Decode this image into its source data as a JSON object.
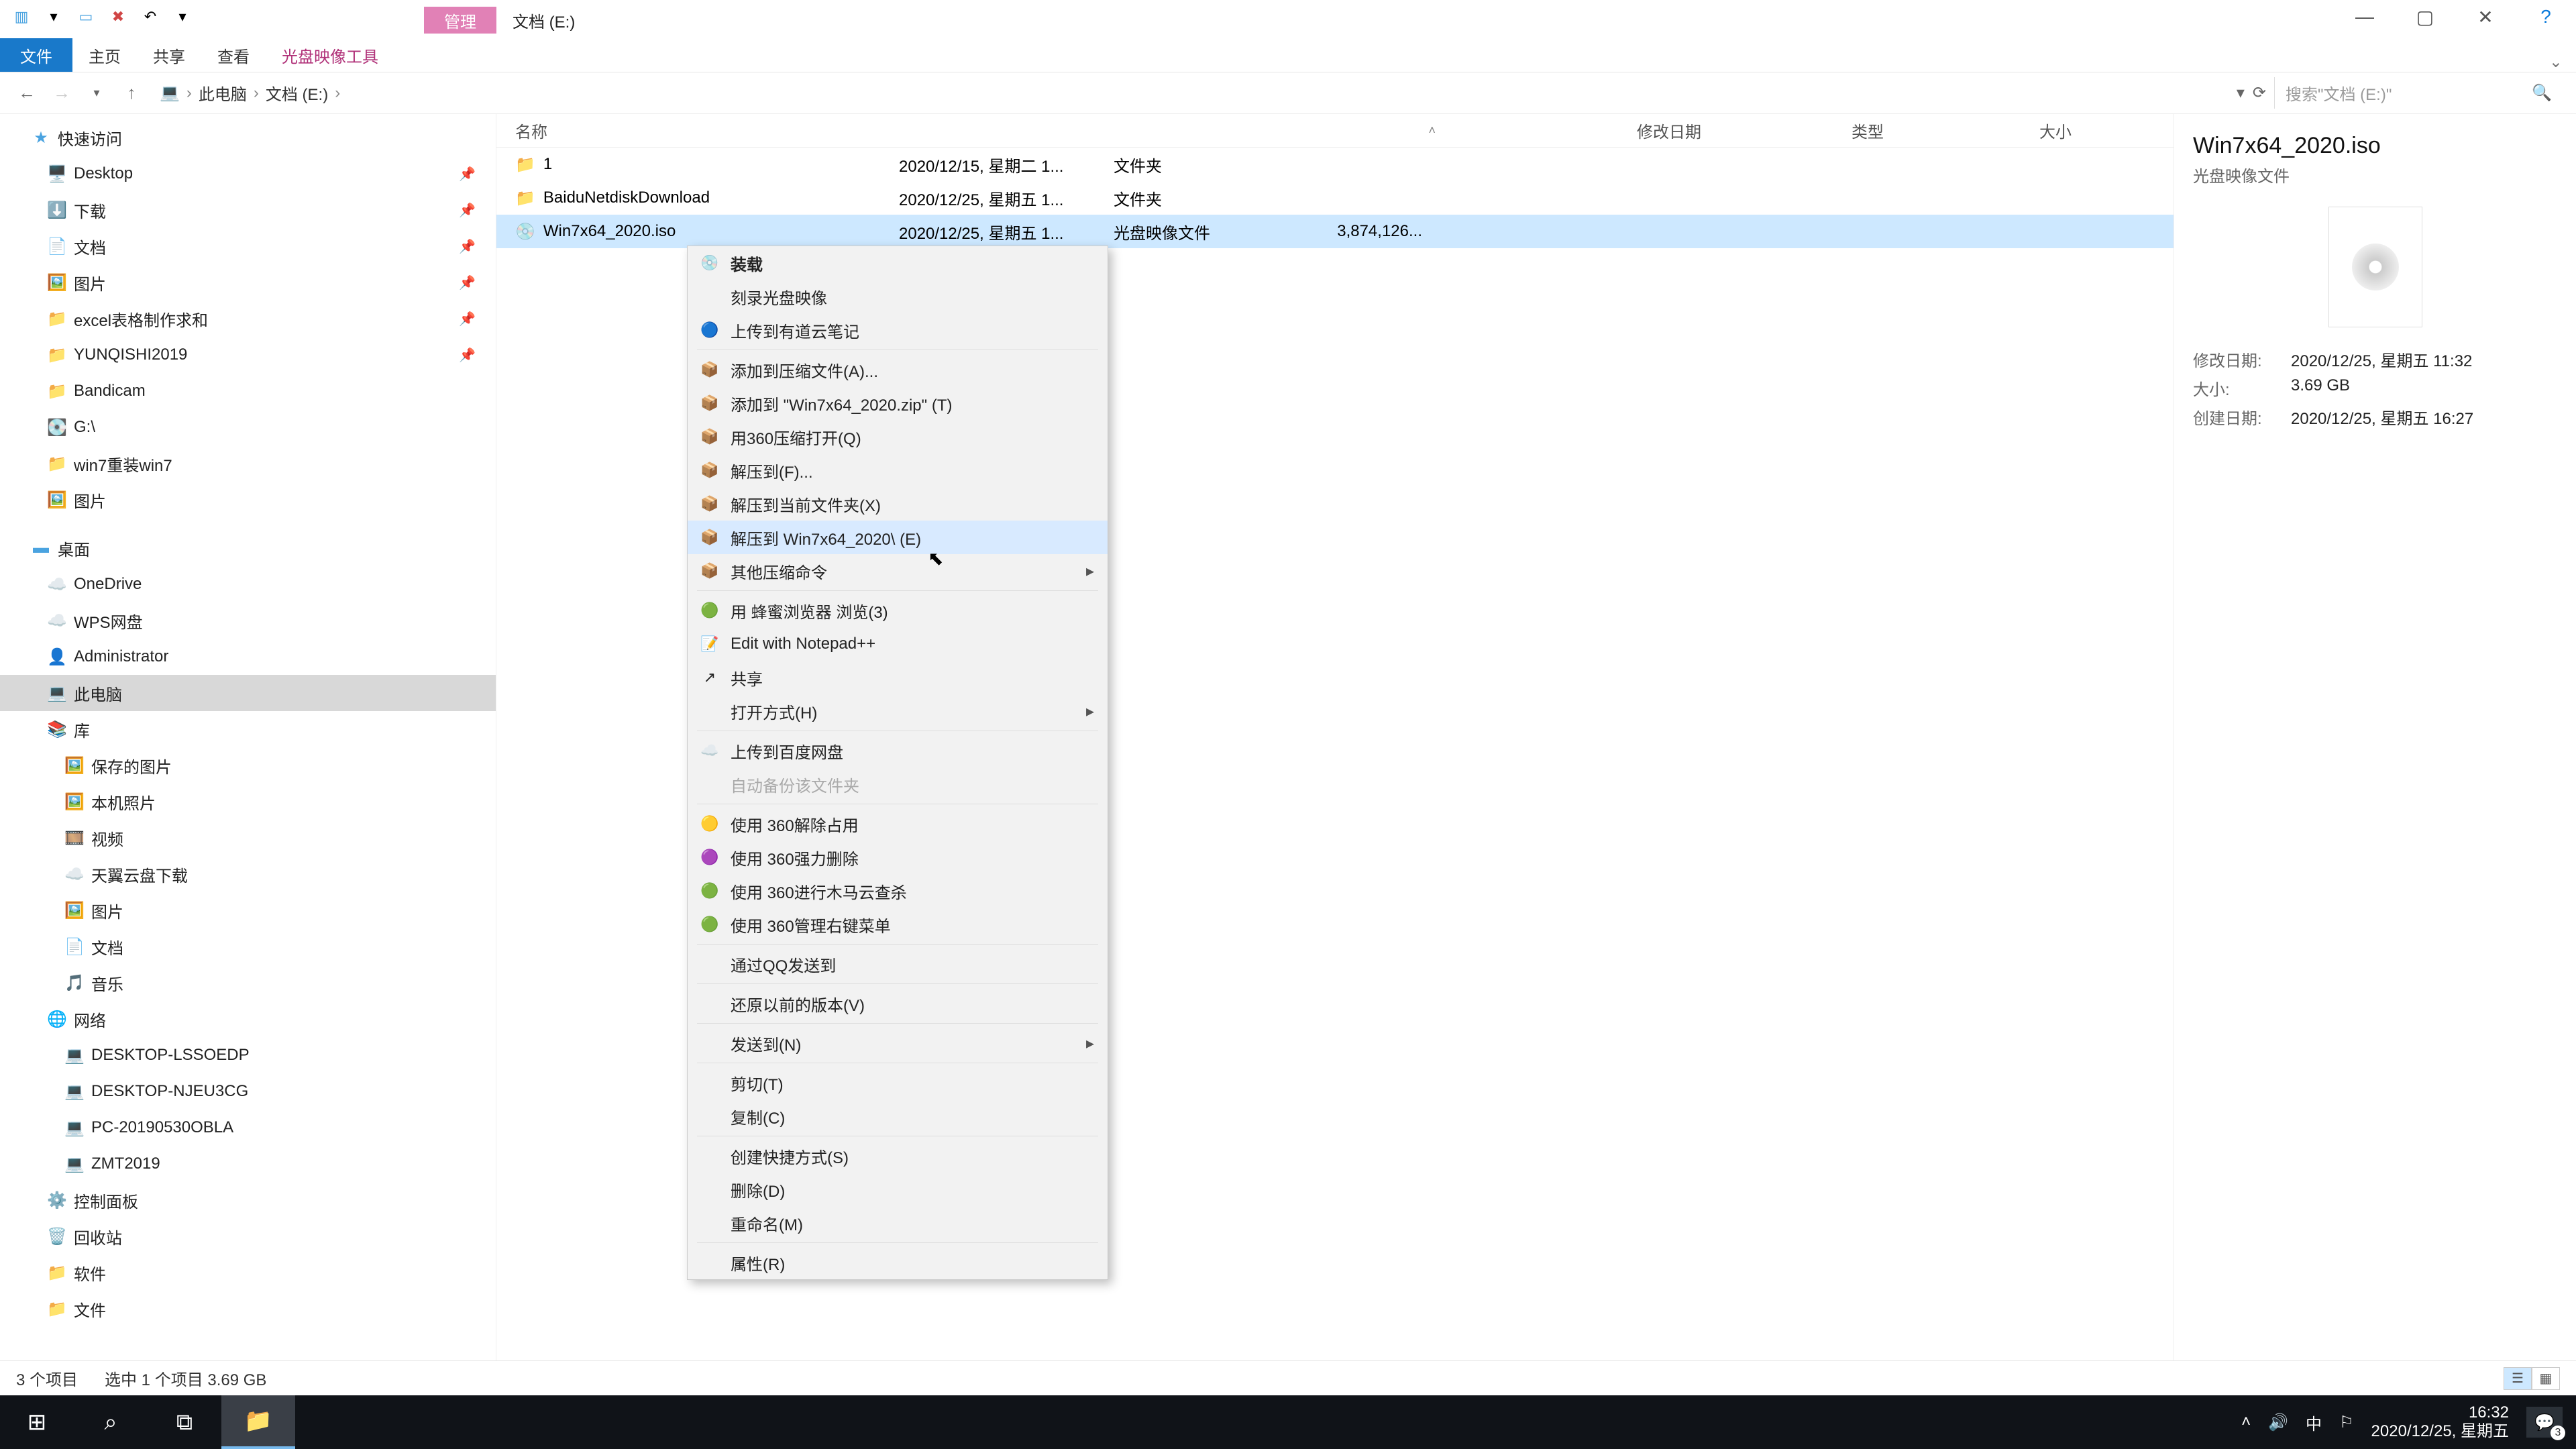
{
  "window": {
    "context_tab": "管理",
    "location_label": "文档 (E:)",
    "controls": {
      "min": "—",
      "max": "▢",
      "close": "✕",
      "help": "?"
    }
  },
  "ribbon": {
    "file": "文件",
    "tabs": [
      "主页",
      "共享",
      "查看"
    ],
    "context_tool": "光盘映像工具"
  },
  "address": {
    "crumbs": [
      "此电脑",
      "文档 (E:)"
    ],
    "search_placeholder": "搜索\"文档 (E:)\""
  },
  "tree": {
    "quick": {
      "label": "快速访问",
      "items": [
        {
          "icon": "🖥️",
          "label": "Desktop",
          "pinned": true
        },
        {
          "icon": "⬇️",
          "label": "下载",
          "pinned": true
        },
        {
          "icon": "📄",
          "label": "文档",
          "pinned": true
        },
        {
          "icon": "🖼️",
          "label": "图片",
          "pinned": true
        },
        {
          "icon": "📁",
          "label": "excel表格制作求和",
          "pinned": true
        },
        {
          "icon": "📁",
          "label": "YUNQISHI2019",
          "pinned": true
        },
        {
          "icon": "📁",
          "label": "Bandicam"
        },
        {
          "icon": "💽",
          "label": "G:\\"
        },
        {
          "icon": "📁",
          "label": "win7重装win7"
        },
        {
          "icon": "🖼️",
          "label": "图片"
        }
      ]
    },
    "desktop": {
      "label": "桌面",
      "items": [
        {
          "icon": "☁️",
          "label": "OneDrive",
          "color": "c-blue"
        },
        {
          "icon": "☁️",
          "label": "WPS网盘",
          "color": "c-blue"
        },
        {
          "icon": "👤",
          "label": "Administrator"
        },
        {
          "icon": "💻",
          "label": "此电脑",
          "selected": true
        },
        {
          "icon": "📚",
          "label": "库"
        }
      ]
    },
    "lib_items": [
      {
        "icon": "🖼️",
        "label": "保存的图片"
      },
      {
        "icon": "🖼️",
        "label": "本机照片"
      },
      {
        "icon": "🎞️",
        "label": "视频"
      },
      {
        "icon": "☁️",
        "label": "天翼云盘下载"
      },
      {
        "icon": "🖼️",
        "label": "图片"
      },
      {
        "icon": "📄",
        "label": "文档"
      },
      {
        "icon": "🎵",
        "label": "音乐"
      }
    ],
    "network": {
      "label": "网络",
      "items": [
        {
          "icon": "💻",
          "label": "DESKTOP-LSSOEDP"
        },
        {
          "icon": "💻",
          "label": "DESKTOP-NJEU3CG"
        },
        {
          "icon": "💻",
          "label": "PC-20190530OBLA"
        },
        {
          "icon": "💻",
          "label": "ZMT2019"
        }
      ]
    },
    "extras": [
      {
        "icon": "⚙️",
        "label": "控制面板"
      },
      {
        "icon": "🗑️",
        "label": "回收站"
      },
      {
        "icon": "📁",
        "label": "软件"
      },
      {
        "icon": "📁",
        "label": "文件"
      }
    ]
  },
  "columns": {
    "name": "名称",
    "date": "修改日期",
    "type": "类型",
    "size": "大小"
  },
  "rows": [
    {
      "icon": "📁",
      "name": "1",
      "date": "2020/12/15, 星期二 1...",
      "type": "文件夹",
      "size": ""
    },
    {
      "icon": "📁",
      "name": "BaiduNetdiskDownload",
      "date": "2020/12/25, 星期五 1...",
      "type": "文件夹",
      "size": ""
    },
    {
      "icon": "💿",
      "name": "Win7x64_2020.iso",
      "date": "2020/12/25, 星期五 1...",
      "type": "光盘映像文件",
      "size": "3,874,126...",
      "selected": true
    }
  ],
  "context_menu": [
    {
      "type": "item",
      "icon": "💿",
      "label": "装载",
      "bold": true
    },
    {
      "type": "item",
      "icon": "",
      "label": "刻录光盘映像"
    },
    {
      "type": "item",
      "icon": "🔵",
      "label": "上传到有道云笔记"
    },
    {
      "type": "sep"
    },
    {
      "type": "item",
      "icon": "📦",
      "label": "添加到压缩文件(A)..."
    },
    {
      "type": "item",
      "icon": "📦",
      "label": "添加到 \"Win7x64_2020.zip\" (T)"
    },
    {
      "type": "item",
      "icon": "📦",
      "label": "用360压缩打开(Q)"
    },
    {
      "type": "item",
      "icon": "📦",
      "label": "解压到(F)..."
    },
    {
      "type": "item",
      "icon": "📦",
      "label": "解压到当前文件夹(X)"
    },
    {
      "type": "item",
      "icon": "📦",
      "label": "解压到 Win7x64_2020\\ (E)",
      "hover": true
    },
    {
      "type": "item",
      "icon": "📦",
      "label": "其他压缩命令",
      "arrow": true
    },
    {
      "type": "sep"
    },
    {
      "type": "item",
      "icon": "🟢",
      "label": "用 蜂蜜浏览器 浏览(3)"
    },
    {
      "type": "item",
      "icon": "📝",
      "label": "Edit with Notepad++"
    },
    {
      "type": "item",
      "icon": "↗",
      "label": "共享"
    },
    {
      "type": "item",
      "icon": "",
      "label": "打开方式(H)",
      "arrow": true
    },
    {
      "type": "sep"
    },
    {
      "type": "item",
      "icon": "☁️",
      "label": "上传到百度网盘"
    },
    {
      "type": "item",
      "icon": "",
      "label": "自动备份该文件夹",
      "disabled": true
    },
    {
      "type": "sep"
    },
    {
      "type": "item",
      "icon": "🟡",
      "label": "使用 360解除占用"
    },
    {
      "type": "item",
      "icon": "🟣",
      "label": "使用 360强力删除"
    },
    {
      "type": "item",
      "icon": "🟢",
      "label": "使用 360进行木马云查杀"
    },
    {
      "type": "item",
      "icon": "🟢",
      "label": "使用 360管理右键菜单"
    },
    {
      "type": "sep"
    },
    {
      "type": "item",
      "icon": "",
      "label": "通过QQ发送到"
    },
    {
      "type": "sep"
    },
    {
      "type": "item",
      "icon": "",
      "label": "还原以前的版本(V)"
    },
    {
      "type": "sep"
    },
    {
      "type": "item",
      "icon": "",
      "label": "发送到(N)",
      "arrow": true
    },
    {
      "type": "sep"
    },
    {
      "type": "item",
      "icon": "",
      "label": "剪切(T)"
    },
    {
      "type": "item",
      "icon": "",
      "label": "复制(C)"
    },
    {
      "type": "sep"
    },
    {
      "type": "item",
      "icon": "",
      "label": "创建快捷方式(S)"
    },
    {
      "type": "item",
      "icon": "",
      "label": "删除(D)"
    },
    {
      "type": "item",
      "icon": "",
      "label": "重命名(M)"
    },
    {
      "type": "sep"
    },
    {
      "type": "item",
      "icon": "",
      "label": "属性(R)"
    }
  ],
  "details": {
    "title": "Win7x64_2020.iso",
    "subtype": "光盘映像文件",
    "meta": [
      {
        "label": "修改日期:",
        "value": "2020/12/25, 星期五 11:32"
      },
      {
        "label": "大小:",
        "value": "3.69 GB"
      },
      {
        "label": "创建日期:",
        "value": "2020/12/25, 星期五 16:27"
      }
    ]
  },
  "status": {
    "count": "3 个项目",
    "selection": "选中 1 个项目  3.69 GB"
  },
  "taskbar": {
    "time": "16:32",
    "date": "2020/12/25, 星期五",
    "ime": "中",
    "notif_count": "3"
  }
}
